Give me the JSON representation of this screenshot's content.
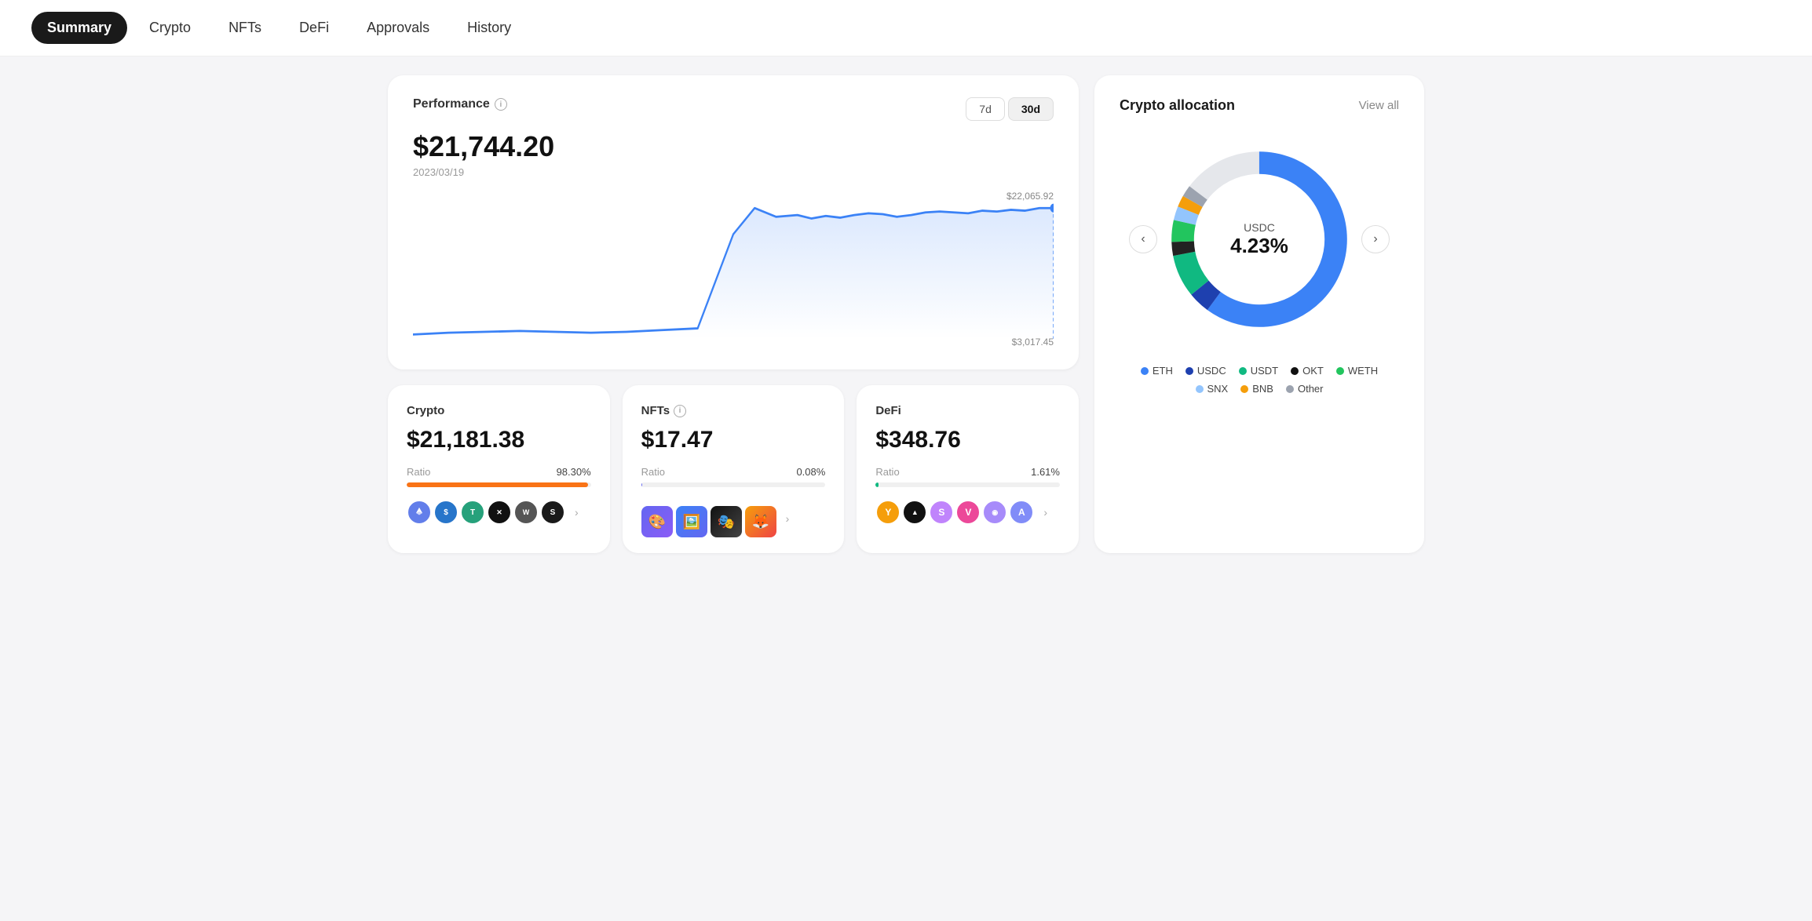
{
  "nav": {
    "items": [
      {
        "label": "Summary",
        "active": true
      },
      {
        "label": "Crypto",
        "active": false
      },
      {
        "label": "NFTs",
        "active": false
      },
      {
        "label": "DeFi",
        "active": false
      },
      {
        "label": "Approvals",
        "active": false
      },
      {
        "label": "History",
        "active": false
      }
    ]
  },
  "performance": {
    "title": "Performance",
    "value": "$21,744.20",
    "date": "2023/03/19",
    "time_buttons": [
      "7d",
      "30d"
    ],
    "active_time": "30d",
    "chart_max": "$22,065.92",
    "chart_min": "$3,017.45"
  },
  "allocation": {
    "title": "Crypto allocation",
    "view_all": "View all",
    "center_label": "USDC",
    "center_value": "4.23%",
    "legend": [
      {
        "label": "ETH",
        "color": "#3B82F6"
      },
      {
        "label": "USDC",
        "color": "#1E40AF"
      },
      {
        "label": "USDT",
        "color": "#10B981"
      },
      {
        "label": "OKT",
        "color": "#111"
      },
      {
        "label": "WETH",
        "color": "#22C55E"
      },
      {
        "label": "SNX",
        "color": "#93C5FD"
      },
      {
        "label": "BNB",
        "color": "#F59E0B"
      },
      {
        "label": "Other",
        "color": "#9CA3AF"
      }
    ]
  },
  "crypto_card": {
    "title": "Crypto",
    "value": "$21,181.38",
    "ratio_label": "Ratio",
    "ratio_pct": "98.30%",
    "bar_color": "#F97316",
    "bar_width": "98.3"
  },
  "nfts_card": {
    "title": "NFTs",
    "value": "$17.47",
    "ratio_label": "Ratio",
    "ratio_pct": "0.08%",
    "bar_color": "#6366F1",
    "bar_width": "0.08"
  },
  "defi_card": {
    "title": "DeFi",
    "value": "$348.76",
    "ratio_label": "Ratio",
    "ratio_pct": "1.61%",
    "bar_color": "#10B981",
    "bar_width": "1.61"
  }
}
